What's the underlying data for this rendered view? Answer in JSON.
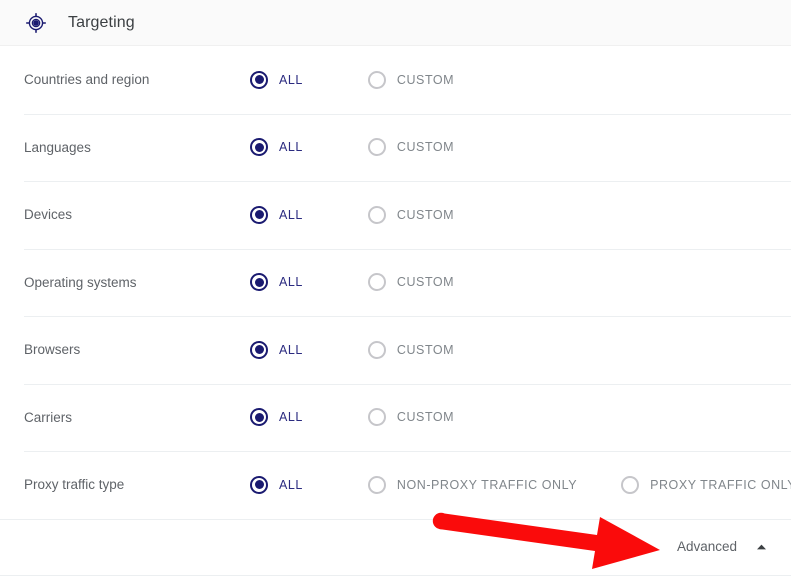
{
  "header": {
    "icon": "location-target-icon",
    "title": "Targeting"
  },
  "colors": {
    "accent_navy": "#1a1a70",
    "selected_label": "#2b2b80",
    "unselected_radio": "#c6c6ca",
    "unselected_label": "#80868b",
    "row_label": "#5f6368",
    "header_bg": "#fafafa",
    "divider": "#eceff1",
    "annotation_red": "#fa0b0b"
  },
  "rows": [
    {
      "label": "Countries and region",
      "options": [
        {
          "label": "ALL",
          "selected": true
        },
        {
          "label": "CUSTOM",
          "selected": false
        }
      ]
    },
    {
      "label": "Languages",
      "options": [
        {
          "label": "ALL",
          "selected": true
        },
        {
          "label": "CUSTOM",
          "selected": false
        }
      ]
    },
    {
      "label": "Devices",
      "options": [
        {
          "label": "ALL",
          "selected": true
        },
        {
          "label": "CUSTOM",
          "selected": false
        }
      ]
    },
    {
      "label": "Operating systems",
      "options": [
        {
          "label": "ALL",
          "selected": true
        },
        {
          "label": "CUSTOM",
          "selected": false
        }
      ]
    },
    {
      "label": "Browsers",
      "options": [
        {
          "label": "ALL",
          "selected": true
        },
        {
          "label": "CUSTOM",
          "selected": false
        }
      ]
    },
    {
      "label": "Carriers",
      "options": [
        {
          "label": "ALL",
          "selected": true
        },
        {
          "label": "CUSTOM",
          "selected": false
        }
      ]
    },
    {
      "label": "Proxy traffic type",
      "options": [
        {
          "label": "ALL",
          "selected": true
        },
        {
          "label": "NON-PROXY TRAFFIC ONLY",
          "selected": false
        },
        {
          "label": "PROXY TRAFFIC ONLY",
          "selected": false
        }
      ]
    }
  ],
  "footer": {
    "advanced_label": "Advanced",
    "caret": "chevron-up-icon",
    "expanded": true
  },
  "annotation": {
    "type": "arrow",
    "color": "#fa0b0b",
    "points_to": "Advanced"
  }
}
